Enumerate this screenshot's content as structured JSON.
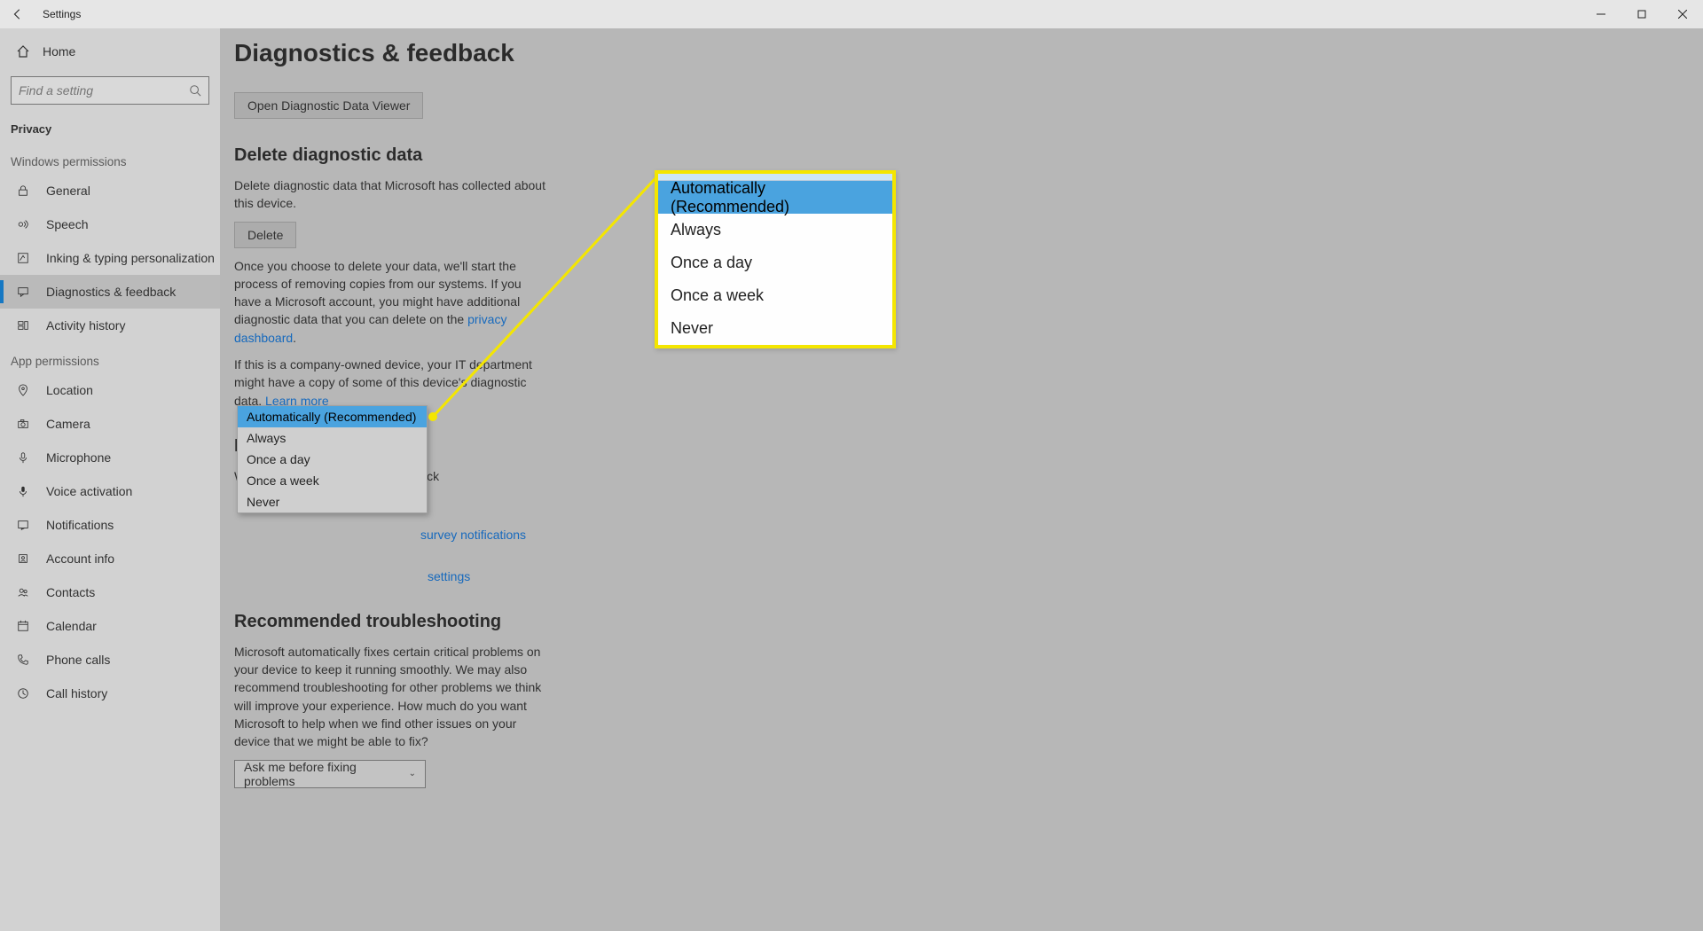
{
  "window": {
    "title": "Settings"
  },
  "sidebar": {
    "home": "Home",
    "search_placeholder": "Find a setting",
    "section": "Privacy",
    "group1": "Windows permissions",
    "group2": "App permissions",
    "items_g1": [
      {
        "label": "General"
      },
      {
        "label": "Speech"
      },
      {
        "label": "Inking & typing personalization"
      },
      {
        "label": "Diagnostics & feedback"
      },
      {
        "label": "Activity history"
      }
    ],
    "items_g2": [
      {
        "label": "Location"
      },
      {
        "label": "Camera"
      },
      {
        "label": "Microphone"
      },
      {
        "label": "Voice activation"
      },
      {
        "label": "Notifications"
      },
      {
        "label": "Account info"
      },
      {
        "label": "Contacts"
      },
      {
        "label": "Calendar"
      },
      {
        "label": "Phone calls"
      },
      {
        "label": "Call history"
      }
    ]
  },
  "main": {
    "title": "Diagnostics & feedback",
    "open_viewer_btn": "Open Diagnostic Data Viewer",
    "delete": {
      "heading": "Delete diagnostic data",
      "p1": "Delete diagnostic data that Microsoft has collected about this device.",
      "btn": "Delete",
      "p2a": "Once you choose to delete your data, we'll start the process of removing copies from our systems. If you have a Microsoft account, you might have additional diagnostic data that you can delete on the ",
      "p2link": "privacy dashboard",
      "p2b": ".",
      "p3a": "If this is a company-owned device, your IT department might have a copy of some of this device's diagnostic data. ",
      "p3link": "Learn more"
    },
    "feedback": {
      "heading": "Feedback frequency",
      "label": "Windows should ask for my feedback",
      "options": [
        "Automatically (Recommended)",
        "Always",
        "Once a day",
        "Once a week",
        "Never"
      ],
      "selected": "Automatically (Recommended)",
      "link_survey": "survey notifications",
      "link_settings": "settings"
    },
    "troubleshoot": {
      "heading": "Recommended troubleshooting",
      "p": "Microsoft automatically fixes certain critical problems on your device to keep it running smoothly. We may also recommend troubleshooting for other problems we think will improve your experience. How much do you want Microsoft to help when we find other issues on your device that we might be able to fix?",
      "select_value": "Ask me before fixing problems"
    }
  }
}
